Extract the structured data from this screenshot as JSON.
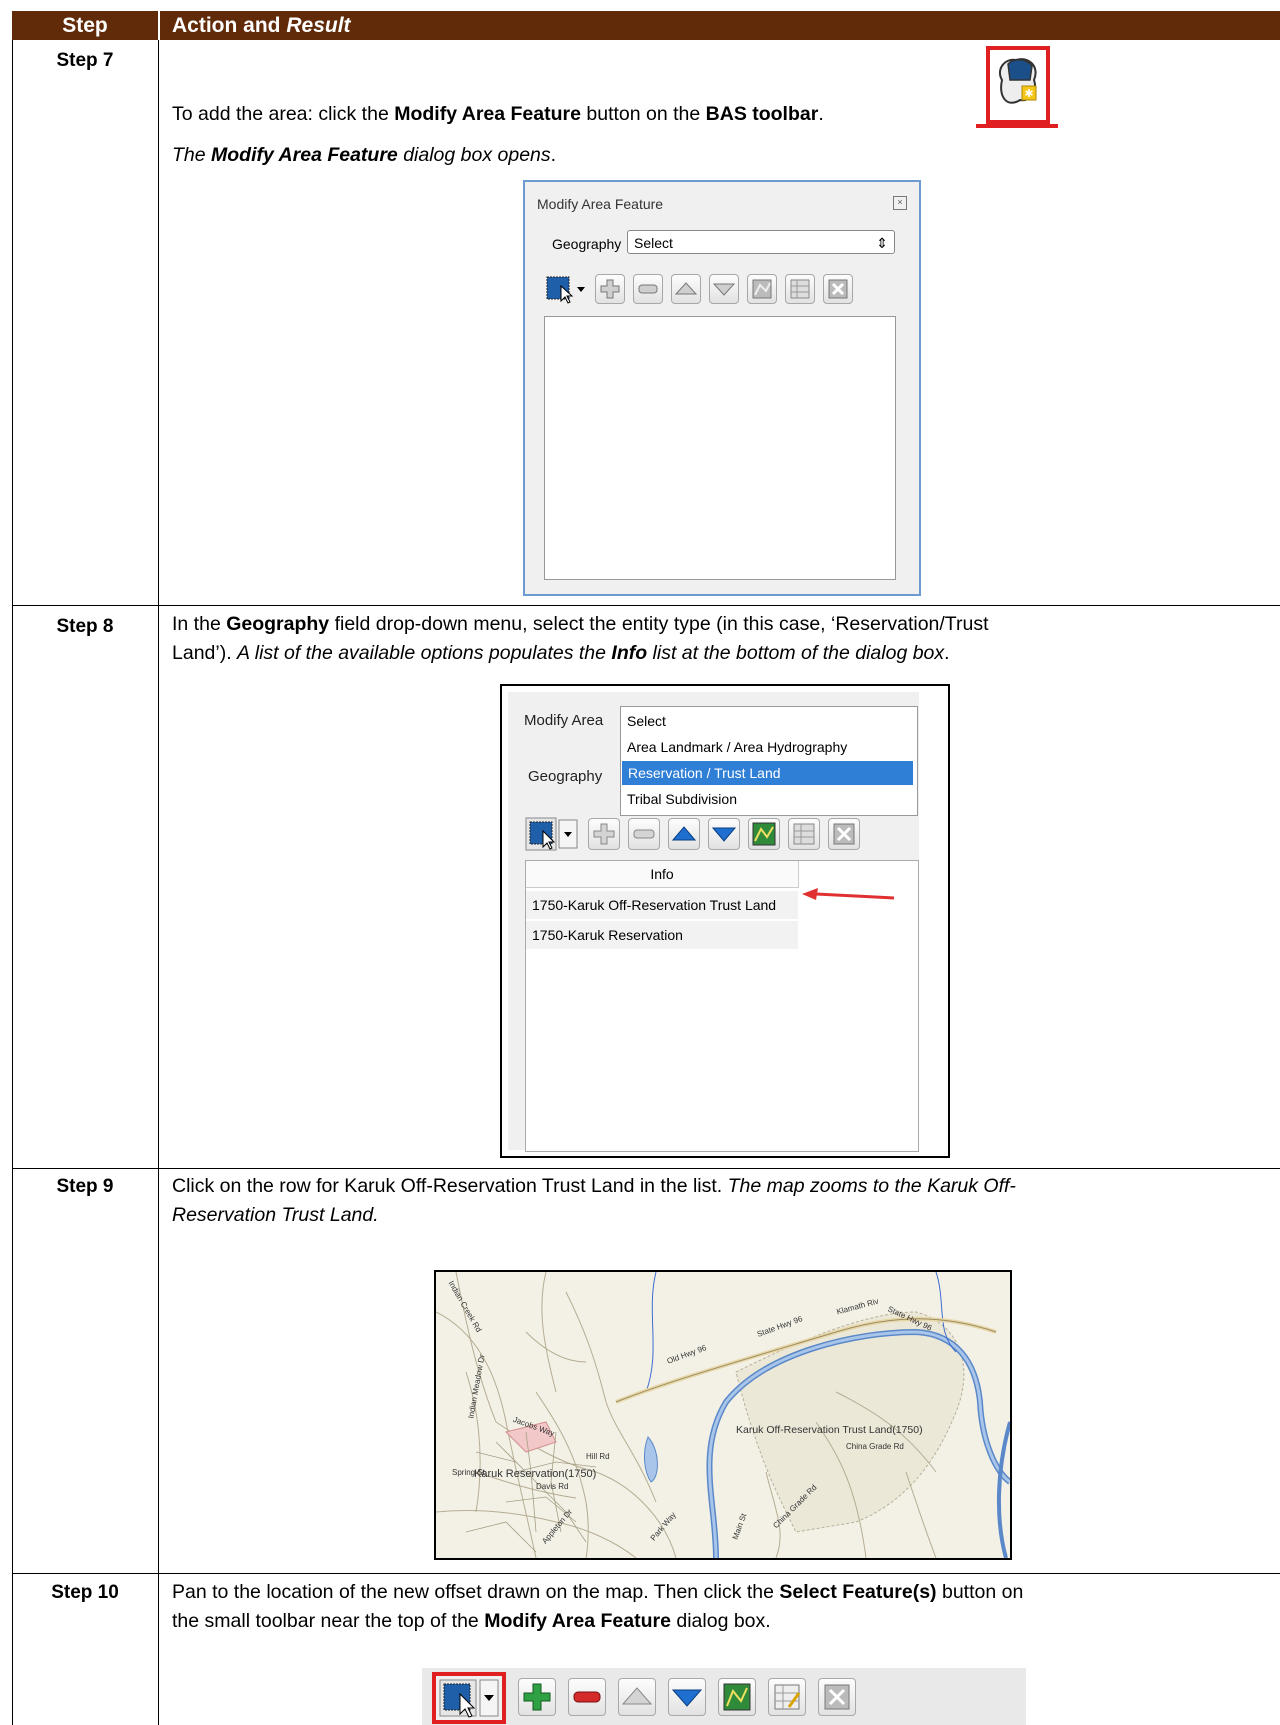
{
  "header": {
    "step": "Step",
    "action_prefix": "Action and ",
    "action_italic": "Result"
  },
  "steps": [
    {
      "label": "Step 7",
      "line1_a": "To add the area: click the ",
      "line1_b": "Modify Area Feature",
      "line1_c": " button on the ",
      "line1_d": "BAS toolbar",
      "line1_e": ".",
      "line2_a": "The ",
      "line2_b": "Modify Area Feature",
      "line2_c": " dialog box opens",
      "line2_d": "."
    },
    {
      "label": "Step 8",
      "l1_a": "In the ",
      "l1_b": "Geography",
      "l1_c": " field drop-down menu, select the entity type (in this case, ‘Reservation/Trust",
      "l2_a": "Land’). ",
      "l2_b": "A list of the available options populates the ",
      "l2_c": "Info",
      "l2_d": " list at the bottom of the dialog box",
      "l2_e": "."
    },
    {
      "label": "Step 9",
      "l1_a": "Click on the row for Karuk Off-Reservation Trust Land in the list. ",
      "l1_b": "The map zooms to the Karuk Off-",
      "l2": "Reservation Trust Land."
    },
    {
      "label": "Step 10",
      "l1_a": "Pan to the location of the new offset drawn on the map. Then click the ",
      "l1_b": "Select Feature(s)",
      "l1_c": " button on",
      "l2_a": "the small toolbar near the top of the ",
      "l2_b": "Modify Area Feature",
      "l2_c": " dialog box."
    }
  ],
  "dialog1": {
    "title": "Modify Area Feature",
    "geography_label": "Geography",
    "select_value": "Select"
  },
  "dialog2": {
    "title": "Modify Area",
    "geography_label": "Geography",
    "menu": [
      "Select",
      "Area Landmark / Area Hydrography",
      "Reservation / Trust Land",
      "Tribal Subdivision"
    ],
    "info_header": "Info",
    "rows": [
      "1750-Karuk Off-Reservation Trust Land",
      "1750-Karuk Reservation"
    ]
  },
  "map": {
    "labels": {
      "trust": "Karuk Off-Reservation Trust Land(1750)",
      "reservation": "Karuk Reservation(1750)",
      "china1": "China Grade Rd",
      "china2": "China Grade Rd",
      "hwy1": "State Hwy 96",
      "hwy2": "State Hwy 96",
      "oldhwy": "Old Hwy 96",
      "klamath": "Klamath Riv",
      "indian": "Indian Creek Rd",
      "indianmeadow": "Indian Meadow Dr",
      "spring": "Spring St",
      "davis": "Davis Rd",
      "park": "Park Way",
      "hill": "Hill Rd",
      "jacobs": "Jacobs Way",
      "apple": "Appleton Dr",
      "main": "Main St"
    }
  },
  "colors": {
    "header_bg": "#612b09",
    "highlight": "#2f7fd6",
    "red_box": "#e02020"
  }
}
